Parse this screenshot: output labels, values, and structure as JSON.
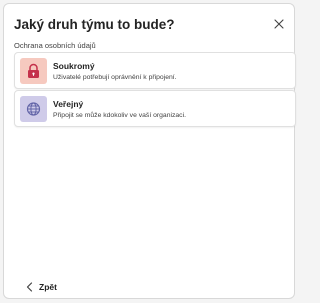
{
  "dialog": {
    "title": "Jaký druh týmu to bude?",
    "section_label": "Ochrana osobních údajů",
    "options": [
      {
        "title": "Soukromý",
        "description": "Uživatelé potřebují oprávnění k připojení.",
        "icon": "lock-icon",
        "icon_bg": "#f6c9bf",
        "icon_color": "#c4314b"
      },
      {
        "title": "Veřejný",
        "description": "Připojit se může kdokoliv ve vaší organizaci.",
        "icon": "globe-icon",
        "icon_bg": "#cfcbe9",
        "icon_color": "#6264a7"
      }
    ],
    "back_label": "Zpět",
    "close_icon": "close-icon"
  }
}
